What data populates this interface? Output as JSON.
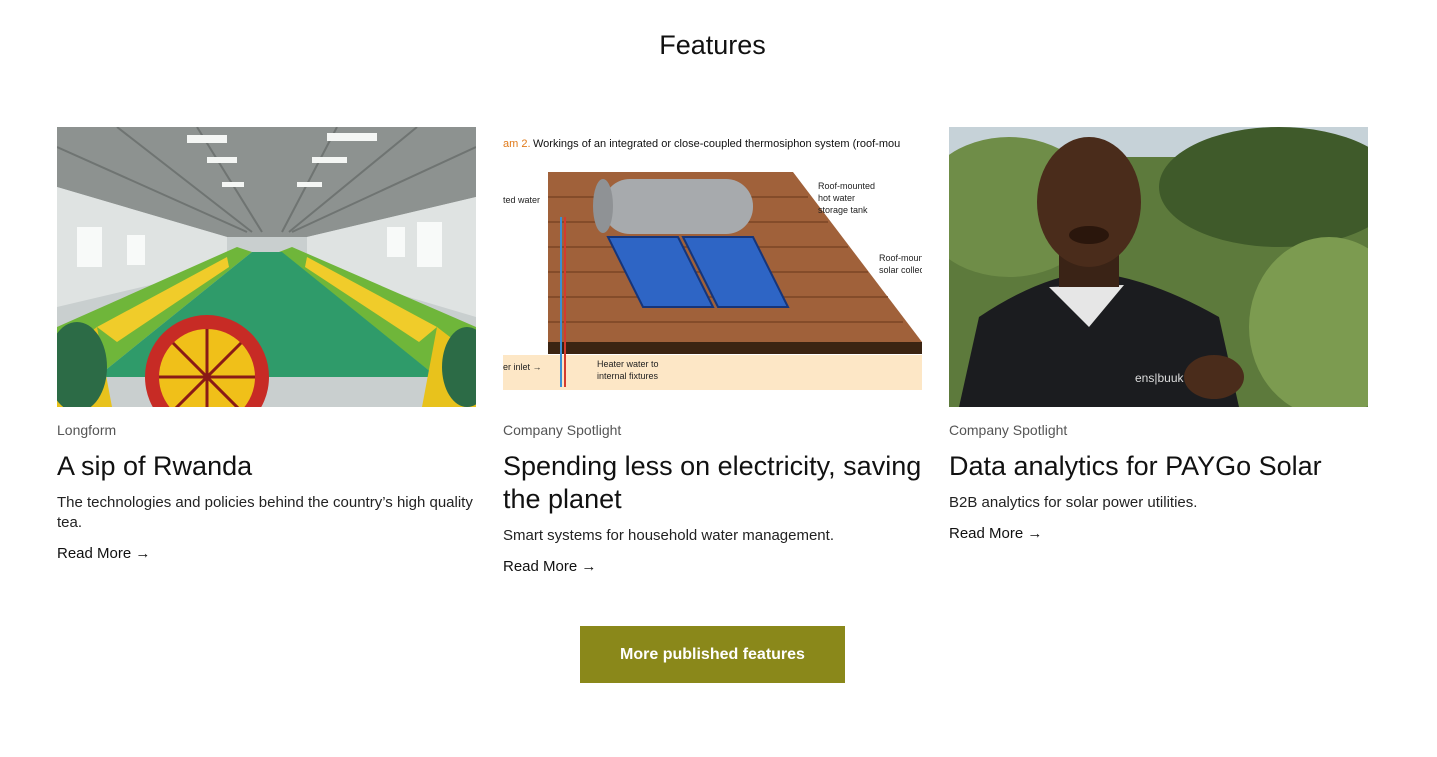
{
  "section": {
    "title": "Features"
  },
  "cards": [
    {
      "category": "Longform",
      "title": "A sip of Rwanda",
      "description": "The technologies and policies behind the country’s high quality tea.",
      "link": "Read More →"
    },
    {
      "category": "Company Spotlight",
      "title": "Spending less on electricity, saving the planet",
      "description": "Smart systems for household water management.",
      "link": "Read More →",
      "image_text": {
        "caption_prefix": "am 2.",
        "caption": "Workings of an integrated or close-coupled thermosiphon system (roof-mou",
        "label_water": "ted water",
        "label_tank": [
          "Roof-mounted",
          "hot water",
          "storage tank"
        ],
        "label_collector": [
          "Roof-moun",
          "solar collec"
        ],
        "label_inlet": "er inlet →",
        "label_heater": [
          "Heater water to",
          "internal fixtures"
        ]
      }
    },
    {
      "category": "Company Spotlight",
      "title": "Data analytics for PAYGo Solar",
      "description": "B2B analytics for solar power utilities.",
      "link": "Read More →",
      "image_text": {
        "shirt_logo": "ens|buuk"
      }
    }
  ],
  "cta": {
    "label": "More published features"
  },
  "colors": {
    "button": "#8a881a",
    "text": "#111111",
    "category": "#555555"
  }
}
